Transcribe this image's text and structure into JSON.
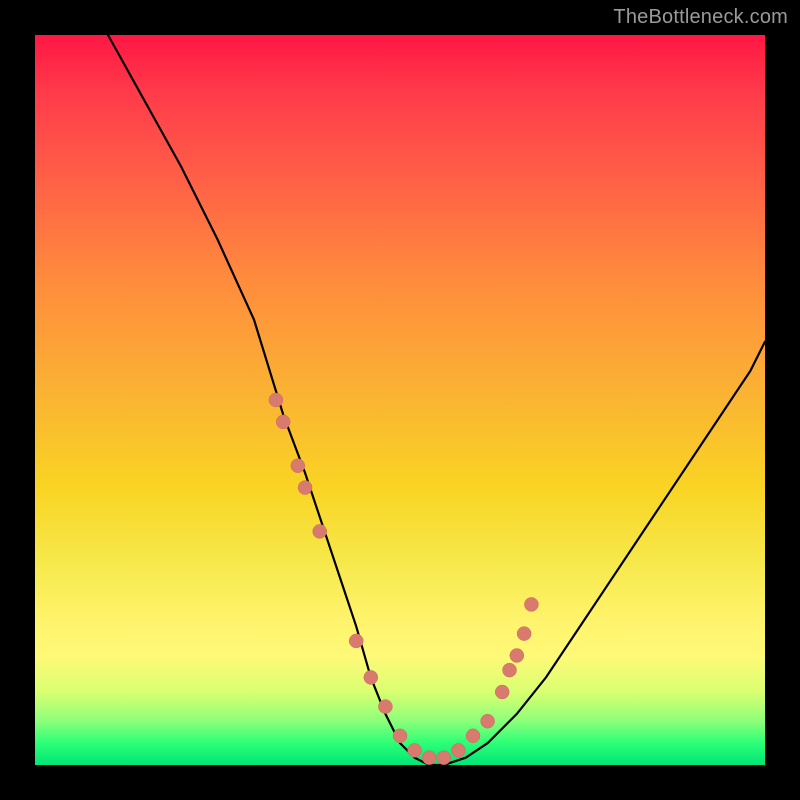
{
  "watermark": "TheBottleneck.com",
  "chart_data": {
    "type": "line",
    "title": "",
    "xlabel": "",
    "ylabel": "",
    "xlim": [
      0,
      100
    ],
    "ylim": [
      0,
      100
    ],
    "grid": false,
    "legend": false,
    "series": [
      {
        "name": "bottleneck-curve",
        "x": [
          10,
          15,
          20,
          25,
          30,
          34,
          37,
          40,
          42,
          44,
          46,
          48,
          50,
          52,
          54,
          56,
          59,
          62,
          66,
          70,
          74,
          78,
          82,
          86,
          90,
          94,
          98,
          100
        ],
        "y": [
          100,
          91,
          82,
          72,
          61,
          48,
          40,
          31,
          25,
          19,
          12,
          7,
          3,
          1,
          0,
          0,
          1,
          3,
          7,
          12,
          18,
          24,
          30,
          36,
          42,
          48,
          54,
          58
        ]
      }
    ],
    "points": {
      "name": "highlight-dots",
      "x": [
        33,
        34,
        36,
        37,
        39,
        44,
        46,
        48,
        50,
        52,
        54,
        56,
        58,
        60,
        62,
        64,
        65,
        66,
        67,
        68
      ],
      "y": [
        50,
        47,
        41,
        38,
        32,
        17,
        12,
        8,
        4,
        2,
        1,
        1,
        2,
        4,
        6,
        10,
        13,
        15,
        18,
        22
      ]
    },
    "gradient_stops": [
      {
        "pos": 0,
        "color": "#ff1744"
      },
      {
        "pos": 33,
        "color": "#ff8a3d"
      },
      {
        "pos": 62,
        "color": "#f9d423"
      },
      {
        "pos": 85,
        "color": "#fff978"
      },
      {
        "pos": 100,
        "color": "#00e676"
      }
    ]
  }
}
